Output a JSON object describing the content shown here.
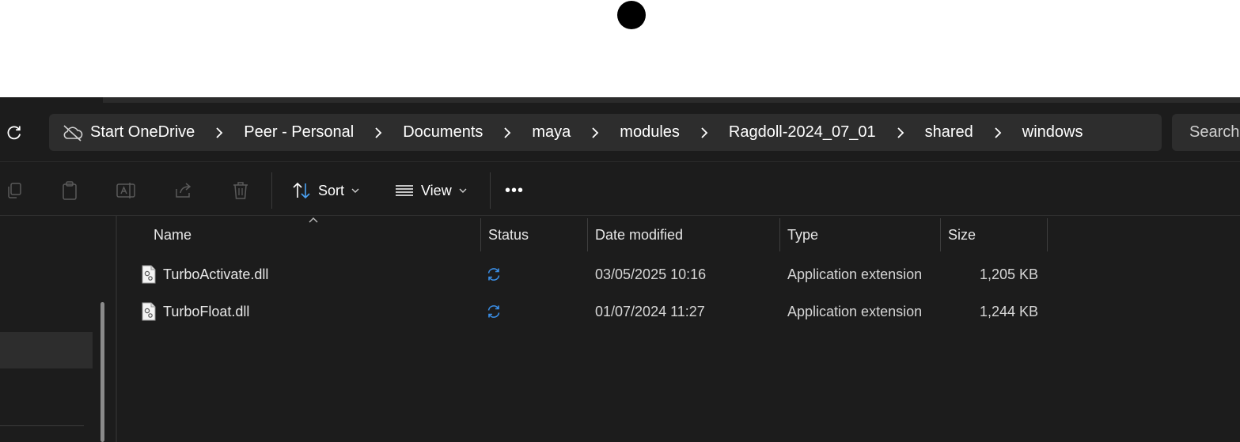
{
  "address": {
    "crumbs": [
      "Start OneDrive",
      "Peer - Personal",
      "Documents",
      "maya",
      "modules",
      "Ragdoll-2024_07_01",
      "shared",
      "windows"
    ]
  },
  "search": {
    "placeholder": "Search"
  },
  "toolbar": {
    "sort_label": "Sort",
    "view_label": "View",
    "more_label": "•••"
  },
  "columns": {
    "name": "Name",
    "status": "Status",
    "date": "Date modified",
    "type": "Type",
    "size": "Size"
  },
  "files": [
    {
      "name": "TurboActivate.dll",
      "status": "sync-pending-icon",
      "date": "03/05/2025 10:16",
      "type": "Application extension",
      "size": "1,205 KB"
    },
    {
      "name": "TurboFloat.dll",
      "status": "sync-pending-icon",
      "date": "01/07/2024 11:27",
      "type": "Application extension",
      "size": "1,244 KB"
    }
  ],
  "colors": {
    "window_bg": "#1c1c1c",
    "bar_bg": "#2d2d2d",
    "sync_blue": "#3a8ee6"
  }
}
